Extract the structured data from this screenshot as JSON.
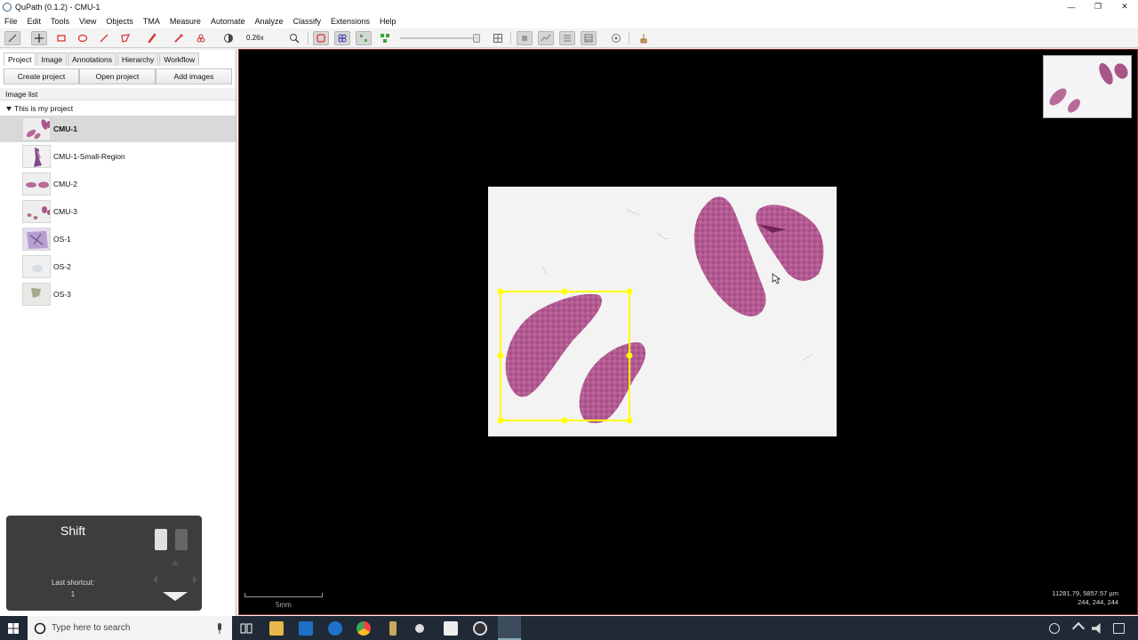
{
  "window": {
    "title": "QuPath (0.1.2) - CMU-1",
    "minimize": "—",
    "restore": "❐",
    "close": "✕"
  },
  "menu": [
    "File",
    "Edit",
    "Tools",
    "View",
    "Objects",
    "TMA",
    "Measure",
    "Automate",
    "Analyze",
    "Classify",
    "Extensions",
    "Help"
  ],
  "toolbar": {
    "zoom": "0.26x"
  },
  "tabs": [
    "Project",
    "Image",
    "Annotations",
    "Hierarchy",
    "Workflow"
  ],
  "project_buttons": {
    "create": "Create project",
    "open": "Open project",
    "add": "Add images"
  },
  "image_list": {
    "header": "Image list",
    "project_name": "This is my project",
    "items": [
      "CMU-1",
      "CMU-1-Small-Region",
      "CMU-2",
      "CMU-3",
      "OS-1",
      "OS-2",
      "OS-3"
    ],
    "selected": "CMU-1"
  },
  "viewer": {
    "scale_label": "5mm",
    "coords": "11281.79, 5857.57 µm",
    "rgb": "244, 244, 244",
    "annotation_color": "#ffff00",
    "tissue_color": "#b05a8e"
  },
  "shortcut_overlay": {
    "key": "Shift",
    "last_label": "Last shortcut:",
    "last_value": "1"
  },
  "taskbar": {
    "search_placeholder": "Type here to search"
  }
}
